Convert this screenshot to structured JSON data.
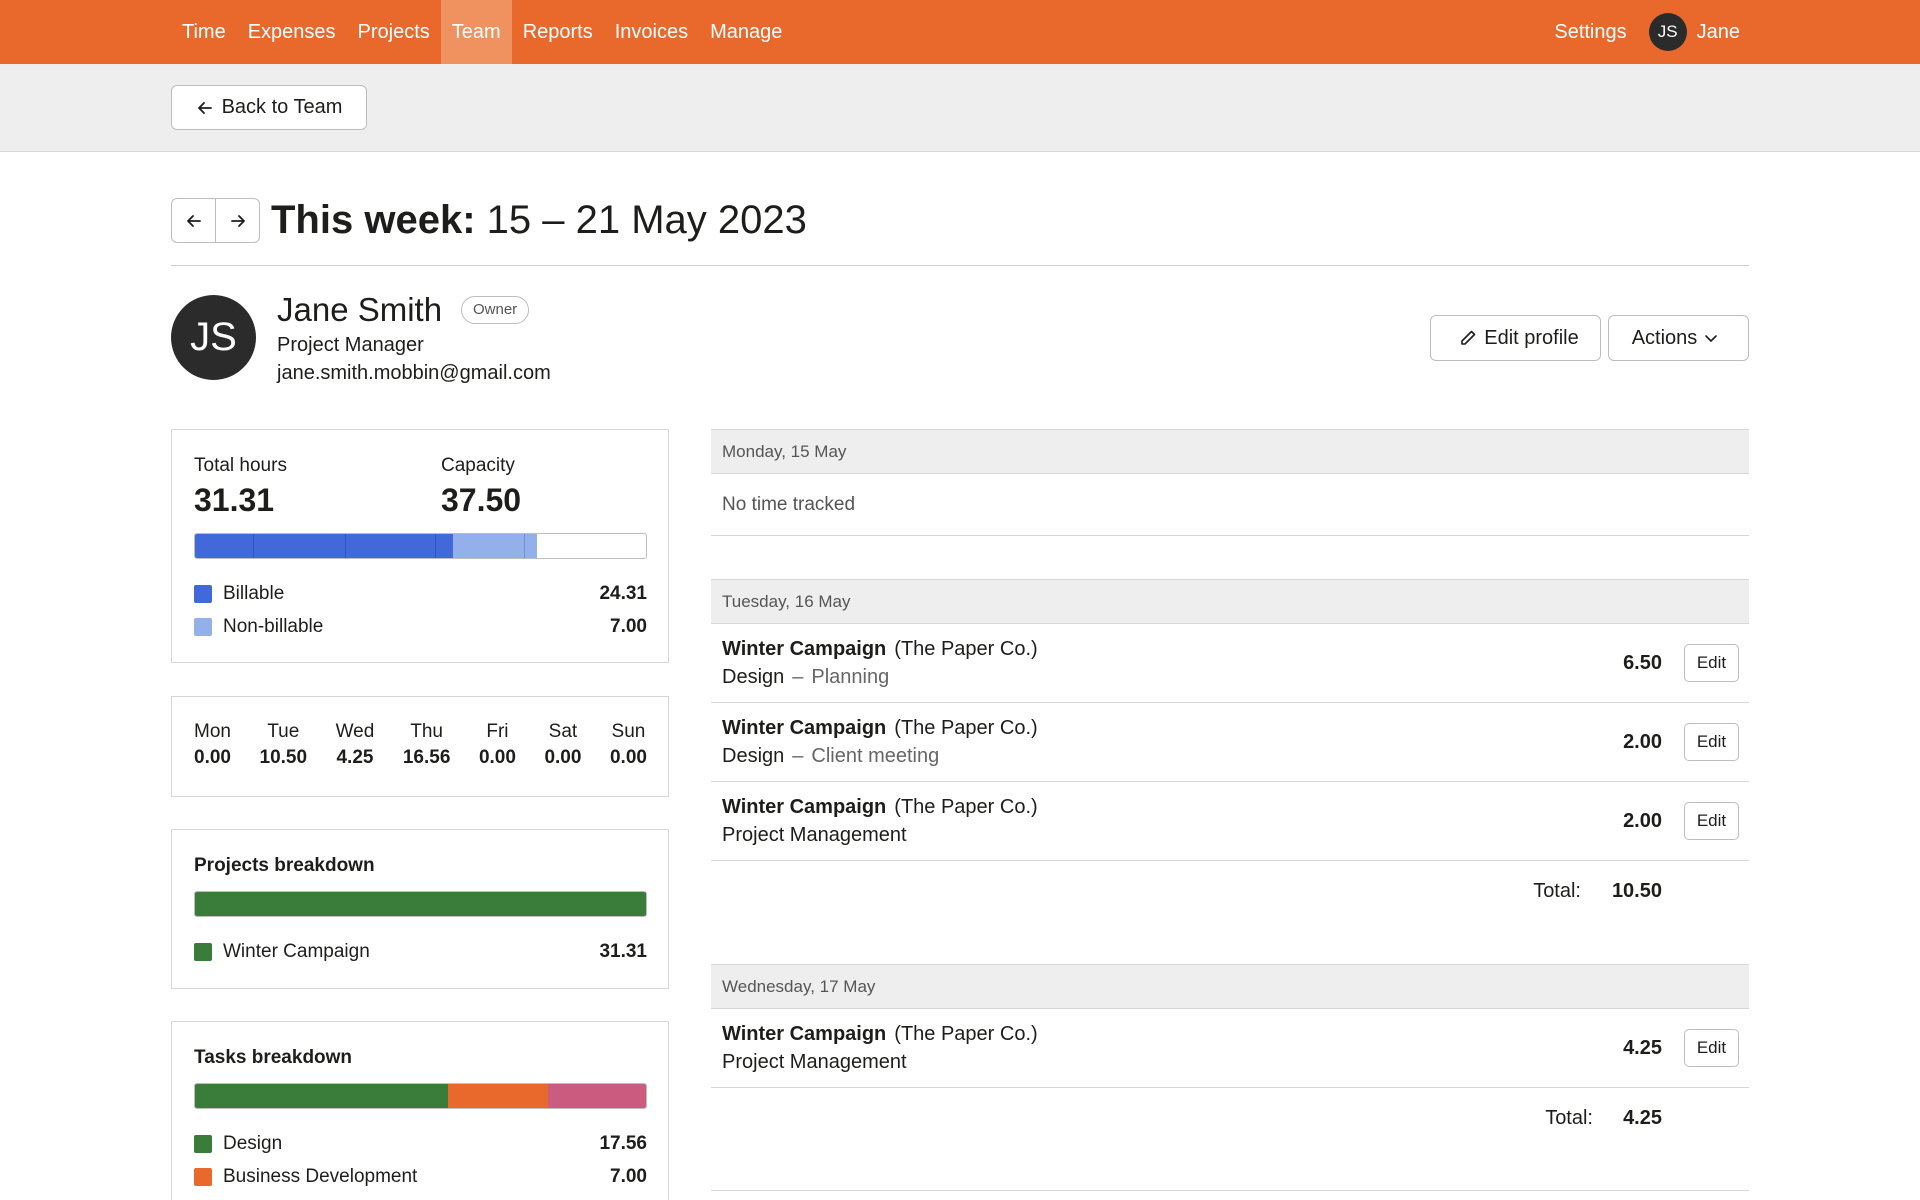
{
  "nav": {
    "items": [
      {
        "label": "Time",
        "active": false
      },
      {
        "label": "Expenses",
        "active": false
      },
      {
        "label": "Projects",
        "active": false
      },
      {
        "label": "Team",
        "active": true
      },
      {
        "label": "Reports",
        "active": false
      },
      {
        "label": "Invoices",
        "active": false
      },
      {
        "label": "Manage",
        "active": false
      }
    ],
    "settings_label": "Settings",
    "user_initials": "JS",
    "user_name": "Jane"
  },
  "subbar": {
    "back_label": "Back to Team"
  },
  "week": {
    "prefix": "This week:",
    "range": " 15 – 21 May 2023"
  },
  "profile": {
    "initials": "JS",
    "name": "Jane Smith",
    "badge": "Owner",
    "role": "Project Manager",
    "email": "jane.smith.mobbin@gmail.com",
    "edit_label": "Edit profile",
    "actions_label": "Actions"
  },
  "summary": {
    "total_label": "Total hours",
    "total_value": "31.31",
    "capacity_label": "Capacity",
    "capacity_value": "37.50",
    "billable_label": "Billable",
    "billable_value": "24.31",
    "nonbillable_label": "Non-billable",
    "nonbillable_value": "7.00",
    "colors": {
      "billable": "#4169d9",
      "nonbillable": "#94b0ea"
    }
  },
  "days": [
    {
      "name": "Mon",
      "value": "0.00"
    },
    {
      "name": "Tue",
      "value": "10.50"
    },
    {
      "name": "Wed",
      "value": "4.25"
    },
    {
      "name": "Thu",
      "value": "16.56"
    },
    {
      "name": "Fri",
      "value": "0.00"
    },
    {
      "name": "Sat",
      "value": "0.00"
    },
    {
      "name": "Sun",
      "value": "0.00"
    }
  ],
  "projects": {
    "title": "Projects breakdown",
    "items": [
      {
        "label": "Winter Campaign",
        "value": "31.31",
        "color": "#3a7d3a"
      }
    ]
  },
  "tasks": {
    "title": "Tasks breakdown",
    "items": [
      {
        "label": "Design",
        "value": "17.56",
        "color": "#3a7d3a"
      },
      {
        "label": "Business Development",
        "value": "7.00",
        "color": "#e9692c"
      }
    ],
    "extra_color": "#cc5b80"
  },
  "timesheet": {
    "monday": {
      "header": "Monday, 15 May",
      "empty": "No time tracked"
    },
    "tuesday": {
      "header": "Tuesday, 16 May",
      "entries": [
        {
          "project": "Winter Campaign",
          "client": "(The Paper Co.)",
          "task": "Design",
          "dash": "–",
          "note": "Planning",
          "hours": "6.50",
          "edit": "Edit"
        },
        {
          "project": "Winter Campaign",
          "client": "(The Paper Co.)",
          "task": "Design",
          "dash": "–",
          "note": "Client meeting",
          "hours": "2.00",
          "edit": "Edit"
        },
        {
          "project": "Winter Campaign",
          "client": "(The Paper Co.)",
          "task": "Project Management",
          "dash": "",
          "note": "",
          "hours": "2.00",
          "edit": "Edit"
        }
      ],
      "total_label": "Total:",
      "total_value": "10.50"
    },
    "wednesday": {
      "header": "Wednesday, 17 May",
      "entries": [
        {
          "project": "Winter Campaign",
          "client": "(The Paper Co.)",
          "task": "Project Management",
          "dash": "",
          "note": "",
          "hours": "4.25",
          "edit": "Edit"
        }
      ],
      "total_label": "Total:",
      "total_value": "4.25"
    }
  }
}
